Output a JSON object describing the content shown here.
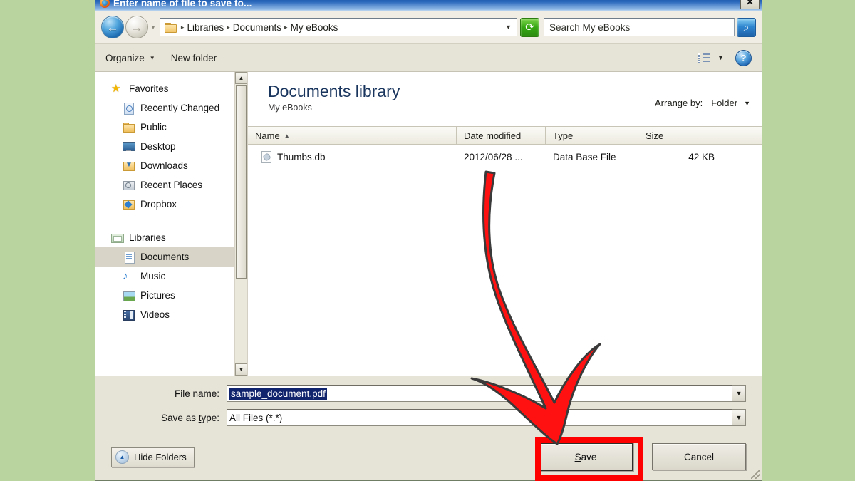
{
  "window": {
    "title": "Enter name of file to save to...",
    "title_icon": "firefox-icon",
    "close_label": "✕"
  },
  "nav": {
    "back_icon": "←",
    "forward_icon": "→",
    "history_caret": "▼",
    "folder_icon": "folder-icon",
    "breadcrumbs": [
      "Libraries",
      "Documents",
      "My eBooks"
    ],
    "crumb_separator": "▸",
    "address_caret": "▼",
    "refresh_icon": "⟳",
    "search_placeholder": "Search My eBooks",
    "search_icon": "⌕"
  },
  "command_bar": {
    "organize_label": "Organize",
    "organize_caret": "▼",
    "new_folder_label": "New folder",
    "view_caret": "▼",
    "help_label": "?"
  },
  "sidebar": {
    "groups": [
      {
        "header": {
          "label": "Favorites",
          "icon": "star-icon"
        },
        "items": [
          {
            "label": "Recently Changed",
            "icon": "recently-changed-icon",
            "selected": false
          },
          {
            "label": "Public",
            "icon": "public-folder-icon",
            "selected": false
          },
          {
            "label": "Desktop",
            "icon": "desktop-icon",
            "selected": false
          },
          {
            "label": "Downloads",
            "icon": "downloads-icon",
            "selected": false
          },
          {
            "label": "Recent Places",
            "icon": "recent-places-icon",
            "selected": false
          },
          {
            "label": "Dropbox",
            "icon": "dropbox-icon",
            "selected": false
          }
        ]
      },
      {
        "header": {
          "label": "Libraries",
          "icon": "libraries-folder-icon"
        },
        "items": [
          {
            "label": "Documents",
            "icon": "documents-icon",
            "selected": true
          },
          {
            "label": "Music",
            "icon": "music-icon",
            "selected": false
          },
          {
            "label": "Pictures",
            "icon": "pictures-icon",
            "selected": false
          },
          {
            "label": "Videos",
            "icon": "videos-icon",
            "selected": false
          }
        ]
      }
    ],
    "scroll_up_icon": "▲",
    "scroll_down_icon": "▼"
  },
  "content": {
    "library_title": "Documents library",
    "library_subtitle": "My eBooks",
    "arrange_by_label": "Arrange by:",
    "arrange_by_value": "Folder",
    "arrange_by_caret": "▼",
    "columns": [
      {
        "label": "Name",
        "sort_indicator": "▲"
      },
      {
        "label": "Date modified",
        "sort_indicator": ""
      },
      {
        "label": "Type",
        "sort_indicator": ""
      },
      {
        "label": "Size",
        "sort_indicator": ""
      }
    ],
    "files": [
      {
        "name": "Thumbs.db",
        "date_modified": "2012/06/28 ...",
        "type": "Data Base File",
        "size": "42 KB",
        "icon": "file-icon"
      }
    ]
  },
  "form": {
    "file_name_label_pre": "File ",
    "file_name_label_key": "n",
    "file_name_label_post": "ame:",
    "file_name_value": "sample_document.pdf",
    "file_name_caret": "▼",
    "save_as_type_label_pre": "Save as ",
    "save_as_type_label_key": "t",
    "save_as_type_label_post": "ype:",
    "save_as_type_value": "All Files (*.*)",
    "save_as_type_caret": "▼"
  },
  "buttons": {
    "hide_folders_label": "Hide Folders",
    "hide_folders_icon": "▲",
    "save_label_pre": "",
    "save_label_key": "S",
    "save_label_post": "ave",
    "cancel_label": "Cancel"
  },
  "annotation": {
    "arrow_color": "#ff1111",
    "arrow_outline": "#3a3a3a",
    "highlight_color": "#ff0000",
    "highlight_target": "save-button"
  },
  "colors": {
    "desktop_background": "#bad4a0",
    "title_bar": "#2766bb",
    "window_chrome": "#e6e3d7",
    "library_title": "#19355e",
    "selection": "#10246e"
  }
}
